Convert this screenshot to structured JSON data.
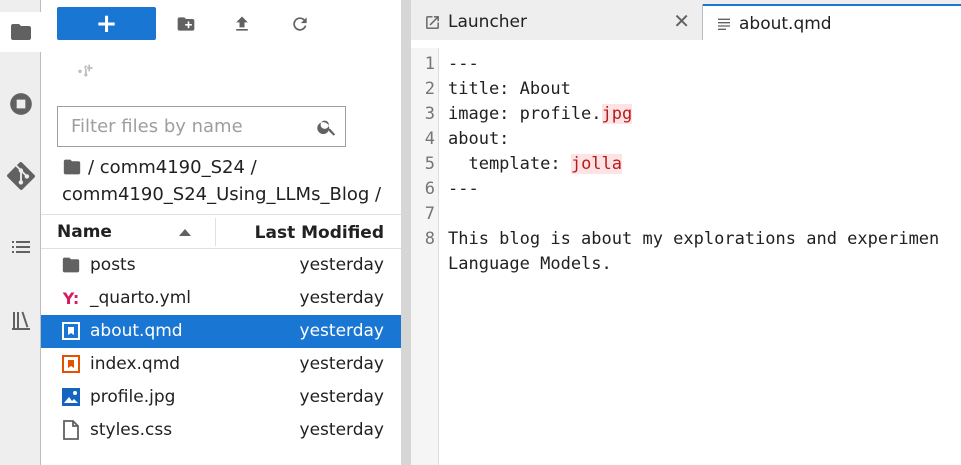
{
  "activity_bar": {
    "items": [
      {
        "icon": "folder-icon",
        "active": true
      },
      {
        "icon": "running-stop-icon",
        "active": false
      },
      {
        "icon": "git-icon",
        "active": false
      },
      {
        "icon": "toc-list-icon",
        "active": false
      },
      {
        "icon": "extension-books-icon",
        "active": false
      }
    ]
  },
  "file_browser": {
    "new_button_label": "+",
    "filter_placeholder": "Filter files by name",
    "filter_value": "",
    "breadcrumb": {
      "path_line1": "/ comm4190_S24 /",
      "path_line2": "comm4190_S24_Using_LLMs_Blog /"
    },
    "columns": {
      "name": "Name",
      "modified": "Last Modified"
    },
    "files": [
      {
        "name": "posts",
        "modified": "yesterday",
        "type": "folder",
        "selected": false
      },
      {
        "name": "_quarto.yml",
        "modified": "yesterday",
        "type": "yaml",
        "selected": false
      },
      {
        "name": "about.qmd",
        "modified": "yesterday",
        "type": "qmd",
        "selected": true
      },
      {
        "name": "index.qmd",
        "modified": "yesterday",
        "type": "qmd",
        "selected": false
      },
      {
        "name": "profile.jpg",
        "modified": "yesterday",
        "type": "image",
        "selected": false
      },
      {
        "name": "styles.css",
        "modified": "yesterday",
        "type": "file",
        "selected": false
      }
    ]
  },
  "editor": {
    "tabs": [
      {
        "label": "Launcher",
        "active": false,
        "close": "✕"
      },
      {
        "label": "about.qmd",
        "active": true
      }
    ],
    "lines": [
      {
        "n": "1",
        "parts": [
          {
            "t": "---"
          }
        ]
      },
      {
        "n": "2",
        "parts": [
          {
            "t": "title: About"
          }
        ]
      },
      {
        "n": "3",
        "parts": [
          {
            "t": "image: profile."
          },
          {
            "t": "jpg",
            "hl": true
          }
        ]
      },
      {
        "n": "4",
        "parts": [
          {
            "t": "about:"
          }
        ]
      },
      {
        "n": "5",
        "parts": [
          {
            "t": "  template: "
          },
          {
            "t": "jolla",
            "hl": true
          }
        ]
      },
      {
        "n": "6",
        "parts": [
          {
            "t": "---"
          }
        ]
      },
      {
        "n": "7",
        "parts": [
          {
            "t": ""
          }
        ]
      },
      {
        "n": "8",
        "parts": [
          {
            "t": "This blog is about my explorations and experimen"
          }
        ]
      },
      {
        "n": "",
        "parts": [
          {
            "t": "Language Models."
          }
        ]
      }
    ]
  },
  "colors": {
    "accent": "#1976d2",
    "highlight_bg": "#fde3e3",
    "yaml_icon": "#d81b60",
    "qmd_icon": "#e65100"
  }
}
